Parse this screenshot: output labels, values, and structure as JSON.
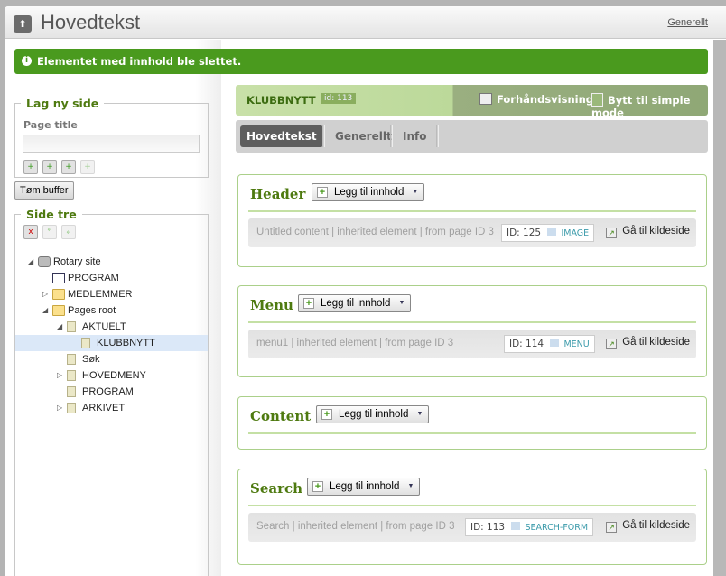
{
  "header": {
    "title": "Hovedtekst",
    "link": "Generellt",
    "icon": "up-arrow-icon"
  },
  "alert": {
    "text": "Elementet med innhold ble slettet.",
    "icon": "info-icon",
    "color": "#4a9a1e"
  },
  "new_page": {
    "legend": "Lag ny side",
    "label": "Page title",
    "value": "",
    "placeholder": ""
  },
  "clear_buffer": "Tøm buffer",
  "tree": {
    "legend": "Side tre",
    "nodes": [
      {
        "label": "Rotary site",
        "icon": "site-icon",
        "toggle": "expanded"
      },
      {
        "label": "PROGRAM",
        "icon": "program-icon",
        "toggle": ""
      },
      {
        "label": "MEDLEMMER",
        "icon": "folder-icon",
        "toggle": "collapsed"
      },
      {
        "label": "Pages root",
        "icon": "folder-open-icon",
        "toggle": "expanded"
      },
      {
        "label": "AKTUELT",
        "icon": "page-icon",
        "toggle": "expanded"
      },
      {
        "label": "KLUBBNYTT",
        "icon": "page-icon",
        "toggle": "",
        "selected": true
      },
      {
        "label": "Søk",
        "icon": "page-icon",
        "toggle": ""
      },
      {
        "label": "HOVEDMENY",
        "icon": "page-icon",
        "toggle": "collapsed"
      },
      {
        "label": "PROGRAM",
        "icon": "page-icon",
        "toggle": ""
      },
      {
        "label": "ARKIVET",
        "icon": "page-icon",
        "toggle": "collapsed"
      }
    ]
  },
  "page": {
    "name": "KLUBBNYTT",
    "id": "id: 113",
    "preview": "Forhåndsvisning",
    "simple_mode": "Bytt til simple mode"
  },
  "tabs": [
    "Hovedtekst",
    "Generellt",
    "Info"
  ],
  "add_label": "Legg til innhold",
  "go_label": "Gå til kildeside",
  "sections": [
    {
      "title": "Header",
      "item": {
        "meta": "Untitled content | inherited element | from page ID 3",
        "id": "ID: 125",
        "type": "IMAGE"
      }
    },
    {
      "title": "Menu",
      "item": {
        "meta": "menu1 | inherited element | from page ID 3",
        "id": "ID: 114",
        "type": "MENU"
      }
    },
    {
      "title": "Content"
    },
    {
      "title": "Search",
      "item": {
        "meta": "Search | inherited element | from page ID 3",
        "id": "ID: 113",
        "type": "SEARCH-FORM"
      }
    }
  ]
}
